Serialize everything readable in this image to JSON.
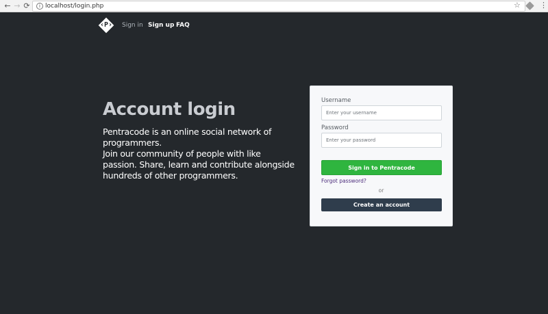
{
  "browser": {
    "back_glyph": "←",
    "forward_glyph": "→",
    "reload_glyph": "⟳",
    "info_glyph": "i",
    "url": "localhost/login.php",
    "bookmark_glyph": "☆",
    "menu_glyph": "⋮"
  },
  "site_nav": {
    "logo_text": "‹P›",
    "links": [
      "Sign in",
      "Sign up",
      "FAQ"
    ]
  },
  "hero": {
    "title": "Account login",
    "lines": [
      "Pentracode is an online social network of",
      "programmers.",
      "Join our community of people with like",
      "passion. Share, learn and contribute alongside",
      "hundreds of other programmers."
    ]
  },
  "login_form": {
    "username_label": "Username",
    "username_placeholder": "Enter your username",
    "password_label": "Password",
    "password_placeholder": "Enter your password",
    "sign_in_label": "Sign in to Pentracode",
    "forgot_label": "Forgot password?",
    "or_label": "or",
    "create_label": "Create an account"
  },
  "colors": {
    "page_background": "#24282c",
    "primary_button": "#2fb53f",
    "secondary_button": "#2f3d4c",
    "link": "#4a2a7a"
  }
}
